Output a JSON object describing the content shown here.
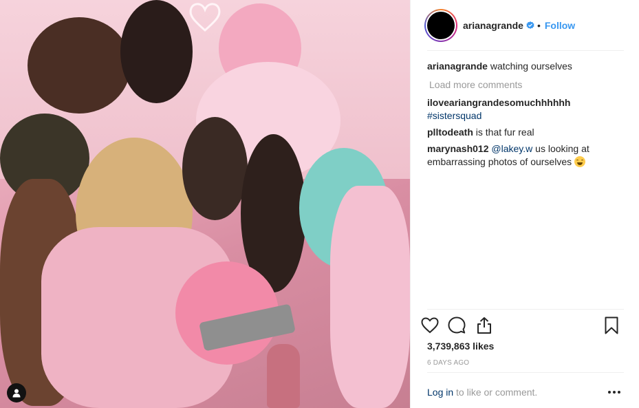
{
  "post": {
    "username": "arianagrande",
    "follow_label": "Follow",
    "separator": "•",
    "caption_author": "arianagrande",
    "caption_text": "watching ourselves",
    "load_more_label": "Load more comments",
    "likes_text": "3,739,863 likes",
    "timestamp": "6 DAYS AGO"
  },
  "comments": [
    {
      "author": "iloveariangrandesomuchhhhhh",
      "text_before": "",
      "link": "#sistersquad",
      "text_after": ""
    },
    {
      "author": "plltodeath",
      "text_before": "is that fur real",
      "link": "",
      "text_after": ""
    },
    {
      "author": "marynash012",
      "text_before": "",
      "link": "@lakey.w",
      "text_after": "us looking at embarrassing photos of ourselves"
    }
  ],
  "footer": {
    "login_label": "Log in",
    "login_suffix": "to like or comment."
  },
  "icons": {
    "verified": "verified-badge-icon",
    "like": "heart-icon",
    "comment": "speech-bubble-icon",
    "share": "share-icon",
    "save": "bookmark-icon",
    "more": "more-options-icon",
    "tagged_users": "user-tag-icon"
  },
  "colors": {
    "link_blue": "#3897f0",
    "text_dark": "#262626",
    "text_muted": "#999999",
    "mention_blue": "#003569"
  }
}
